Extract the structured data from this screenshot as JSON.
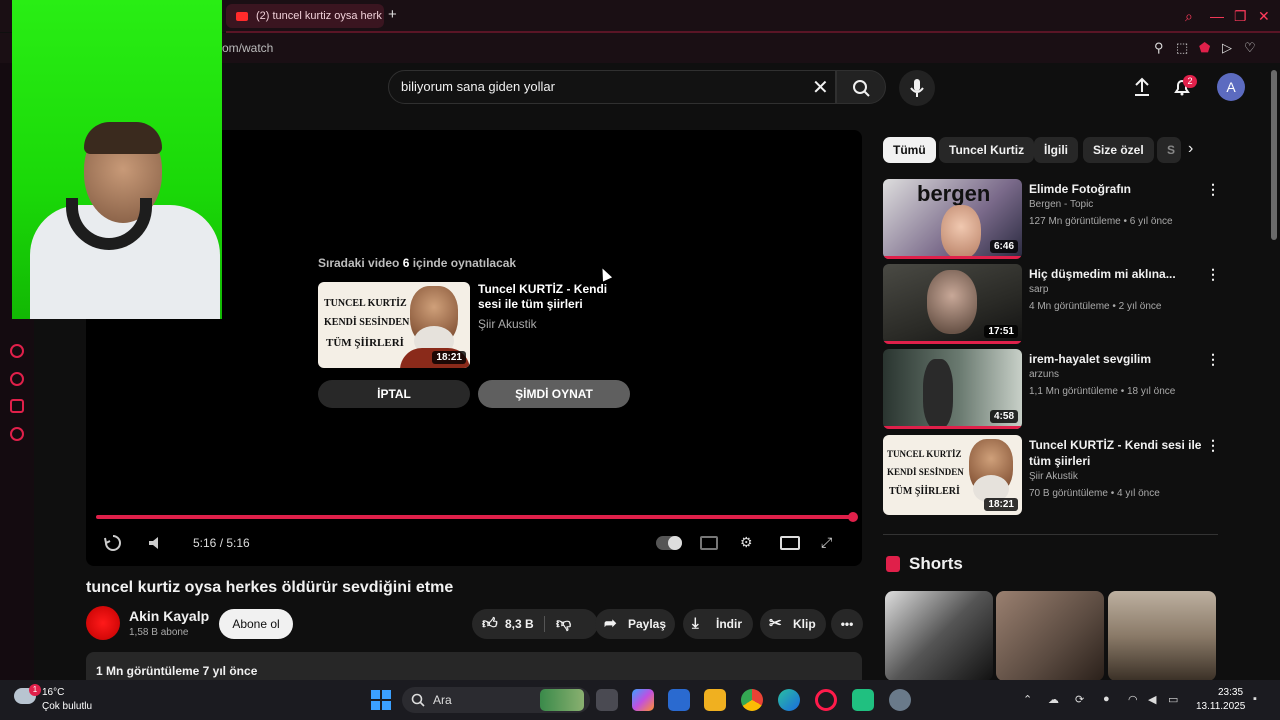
{
  "browser": {
    "tab_title": "(2) tuncel kurtiz oysa herk",
    "new_tab": "+",
    "url": "om/watch"
  },
  "header": {
    "search_query": "biliyorum sana giden yollar",
    "notification_count": "2",
    "avatar_letter": "A"
  },
  "player": {
    "up_next_prefix": "Sıradaki video ",
    "up_next_seconds": "6",
    "up_next_suffix": " içinde oynatılacak",
    "up_next_title": "Tuncel KURTİZ - Kendi sesi ile tüm şiirleri",
    "up_next_channel": "Şiir Akustik",
    "up_next_duration": "18:21",
    "up_next_thumb_lines": [
      "TUNCEL KURTİZ",
      "KENDİ SESİNDEN",
      "TÜM ŞİİRLERİ"
    ],
    "cancel_label": "İPTAL",
    "play_now_label": "ŞİMDİ OYNAT",
    "time_display": "5:16 / 5:16",
    "progress": 1.0
  },
  "video": {
    "title": "tuncel kurtiz oysa herkes öldürür sevdiğini etme",
    "channel": "Akin Kayalp",
    "subscribers": "1,58 B abone",
    "subscribe_label": "Abone ol",
    "likes": "8,3 B",
    "share_label": "Paylaş",
    "download_label": "İndir",
    "clip_label": "Klip",
    "description_meta": "1 Mn görüntüleme  7 yıl önce"
  },
  "chips": [
    "Tümü",
    "Tuncel Kurtiz",
    "İlgili",
    "Size özel",
    "S"
  ],
  "recommendations": [
    {
      "title": "Elimde Fotoğrafın",
      "channel": "Bergen - Topic",
      "meta": "127 Mn görüntüleme • 6 yıl önce",
      "duration": "6:46",
      "thumb_text": "bergen"
    },
    {
      "title": "Hiç düşmedim mi aklına...",
      "channel": "sarp",
      "meta": "4 Mn görüntüleme • 2 yıl önce",
      "duration": "17:51"
    },
    {
      "title": "irem-hayalet sevgilim",
      "channel": "arzuns",
      "meta": "1,1 Mn görüntüleme • 18 yıl önce",
      "duration": "4:58"
    },
    {
      "title": "Tuncel KURTİZ - Kendi sesi ile tüm şiirleri",
      "channel": "Şiir Akustik",
      "meta": "70 B görüntüleme • 4 yıl önce",
      "duration": "18:21"
    }
  ],
  "shorts": {
    "title": "Shorts"
  },
  "taskbar": {
    "temperature": "16°C",
    "weather": "Çok bulutlu",
    "weather_badge": "1",
    "search_label": "Ara",
    "time": "23:35",
    "date": "13.11.2025"
  },
  "colors": {
    "accent": "#e0204a",
    "background": "#0f0f0f",
    "webcam_green": "#22e010"
  }
}
